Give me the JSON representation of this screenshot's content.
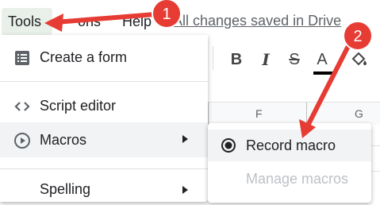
{
  "menubar": {
    "tools": "Tools",
    "addons_partial": "ons",
    "help": "Help",
    "save_status": "All changes saved in Drive"
  },
  "toolbar": {
    "bold": "B",
    "italic": "I",
    "strike": "S",
    "text_color": "A"
  },
  "grid": {
    "columns": [
      "F",
      "G"
    ]
  },
  "tools_menu": {
    "items": [
      {
        "label": "Create a form",
        "icon": "form-icon"
      },
      {
        "label": "Script editor",
        "icon": "code-icon"
      },
      {
        "label": "Macros",
        "icon": "play-circle-icon",
        "has_submenu": true
      },
      {
        "label": "Spelling",
        "has_submenu": true
      }
    ]
  },
  "macros_submenu": {
    "items": [
      {
        "label": "Record macro",
        "icon": "record-icon",
        "enabled": true
      },
      {
        "label": "Manage macros",
        "enabled": false
      }
    ]
  },
  "annotations": {
    "badges": [
      "1",
      "2"
    ],
    "color": "#e63c34"
  },
  "colors": {
    "highlight": "#e8f0e9",
    "hover": "#f1f3f4",
    "disabled_text": "#bdc1c6",
    "annotation_red": "#e63c34"
  }
}
